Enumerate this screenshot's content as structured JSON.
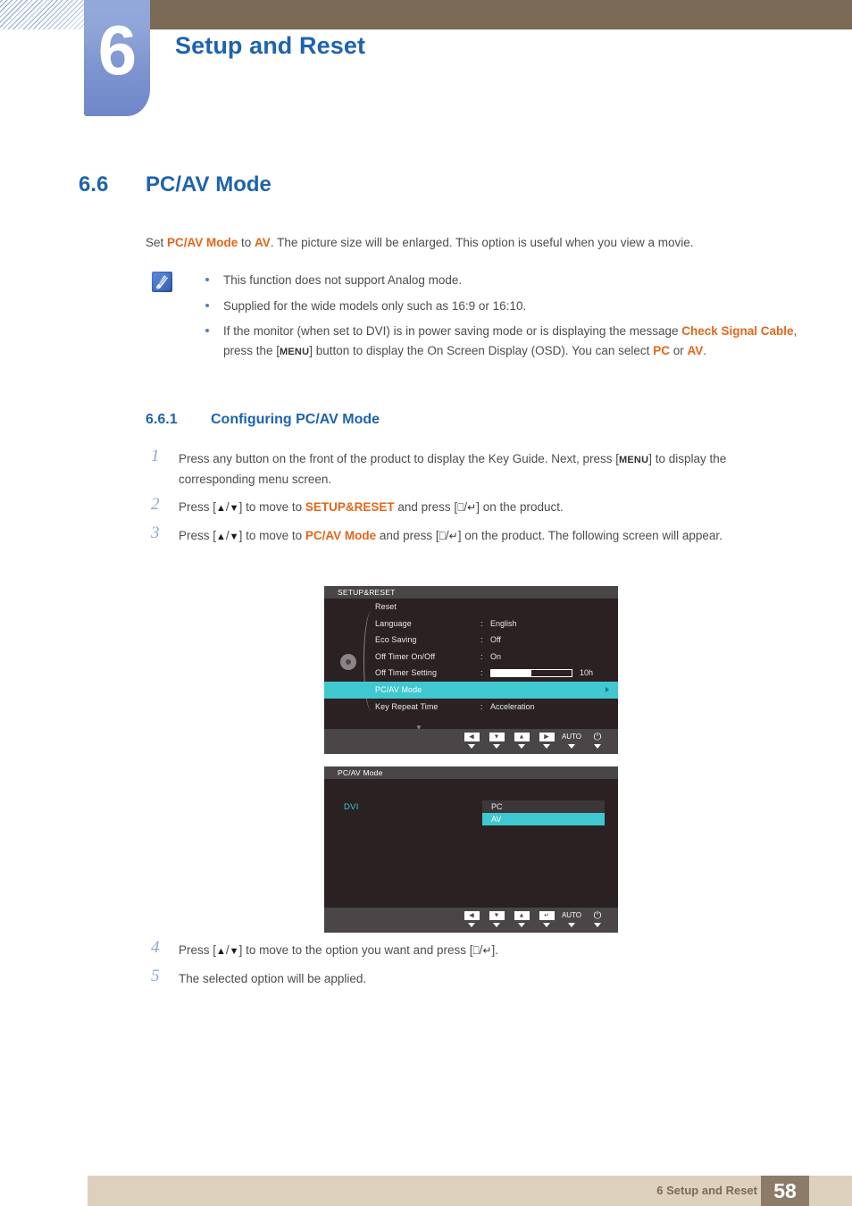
{
  "header": {
    "chapter_number": "6",
    "chapter_title": "Setup and Reset"
  },
  "section": {
    "number": "6.6",
    "title": "PC/AV Mode",
    "intro_prefix": "Set ",
    "intro_bold1": "PC/AV Mode",
    "intro_mid": " to ",
    "intro_bold2": "AV",
    "intro_suffix": ". The picture size will be enlarged. This option is useful when you view a movie."
  },
  "note": {
    "icon": "note-pen-icon",
    "items": [
      {
        "text": "This function does not support Analog mode."
      },
      {
        "text": "Supplied for the wide models only such as 16:9 or 16:10."
      },
      {
        "part1": "If the monitor (when set to DVI) is in power saving mode or is displaying the message ",
        "bold1": "Check Signal Cable",
        "part2": ", press the [",
        "key1": "MENU",
        "part3": "] button to display the On Screen Display (OSD). You can select ",
        "bold2": "PC",
        "part4": " or ",
        "bold3": "AV",
        "part5": "."
      }
    ]
  },
  "subsection": {
    "number": "6.6.1",
    "title": "Configuring PC/AV Mode"
  },
  "steps": [
    {
      "num": "1",
      "part1": "Press any button on the front of the product to display the Key Guide. Next, press [",
      "key1": "MENU",
      "part2": "] to display the corresponding menu screen."
    },
    {
      "num": "2",
      "part1": "Press [",
      "key1": "▲",
      "key_sep": "/",
      "key2": "▼",
      "part2": "] to move to ",
      "bold1": "SETUP&RESET",
      "part3": " and press [",
      "key3": "⎕",
      "key4": "↵",
      "part4": "] on the product."
    },
    {
      "num": "3",
      "part1": "Press [",
      "key1": "▲",
      "key_sep": "/",
      "key2": "▼",
      "part2": "] to move to ",
      "bold1": "PC/AV Mode",
      "part3": " and press [",
      "key3": "⎕",
      "key4": "↵",
      "part4": "] on the product. The following screen will appear."
    }
  ],
  "steps_after": [
    {
      "num": "4",
      "part1": "Press [",
      "key1": "▲",
      "key_sep": "/",
      "key2": "▼",
      "part2": "] to move to the option you want and press [",
      "key3": "⎕",
      "key4": "↵",
      "part3": "]."
    },
    {
      "num": "5",
      "part1": "The selected option will be applied."
    }
  ],
  "osd1": {
    "title": "SETUP&RESET",
    "rows": [
      {
        "label": "Reset",
        "colon": "",
        "value": ""
      },
      {
        "label": "Language",
        "colon": ":",
        "value": "English"
      },
      {
        "label": "Eco Saving",
        "colon": ":",
        "value": "Off"
      },
      {
        "label": "Off Timer On/Off",
        "colon": ":",
        "value": "On"
      },
      {
        "label": "Off Timer Setting",
        "colon": ":",
        "value": "",
        "slider": 50,
        "unit": "10h"
      },
      {
        "label": "PC/AV Mode",
        "colon": "",
        "value": "",
        "selected": true
      },
      {
        "label": "Key Repeat Time",
        "colon": ":",
        "value": "Acceleration"
      }
    ],
    "scroll_indicator": "▼",
    "keyguide": [
      {
        "glyph": "◀",
        "type": "btn"
      },
      {
        "glyph": "▼",
        "type": "btn"
      },
      {
        "glyph": "▲",
        "type": "btn"
      },
      {
        "glyph": "▶",
        "type": "btn"
      },
      {
        "glyph": "AUTO",
        "type": "text"
      },
      {
        "glyph": "⏻",
        "type": "power"
      }
    ]
  },
  "osd2": {
    "title": "PC/AV Mode",
    "source_label": "DVI",
    "colon": ":",
    "options": [
      {
        "label": "PC",
        "selected": false
      },
      {
        "label": "AV",
        "selected": true
      }
    ],
    "keyguide": [
      {
        "glyph": "◀",
        "type": "btn"
      },
      {
        "glyph": "▼",
        "type": "btn"
      },
      {
        "glyph": "▲",
        "type": "btn"
      },
      {
        "glyph": "↵",
        "type": "btn"
      },
      {
        "glyph": "AUTO",
        "type": "text"
      },
      {
        "glyph": "⏻",
        "type": "power"
      }
    ]
  },
  "footer": {
    "text": "6 Setup and Reset",
    "page": "58"
  },
  "colors": {
    "accent_blue": "#1f63ad",
    "accent_orange": "#e2661a",
    "osd_teal": "#3fc8d0",
    "header_brown": "#7a6a56",
    "footer_tan": "#ddd0bd",
    "footer_page_brown": "#8d7b69",
    "tab_blue": "#8fa5d8"
  }
}
